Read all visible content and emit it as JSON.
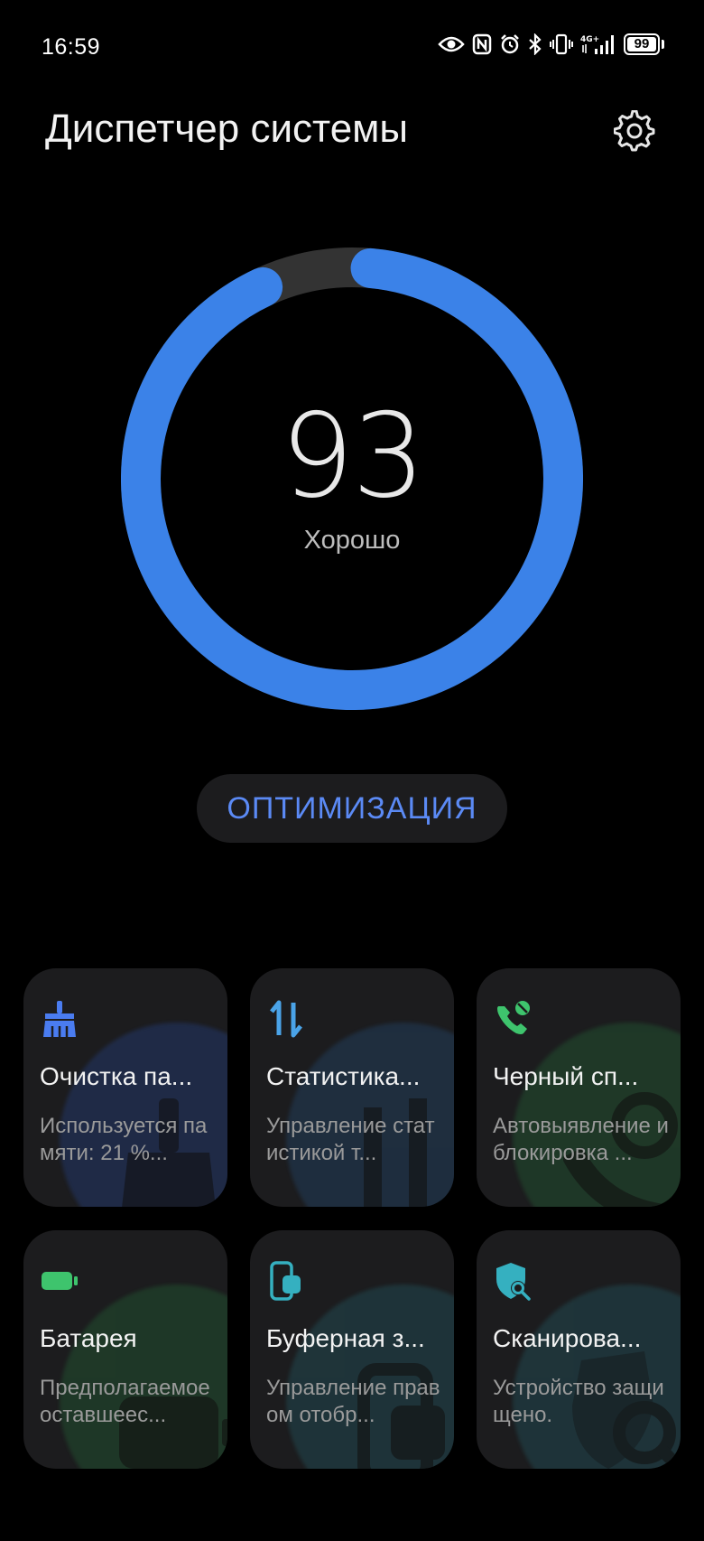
{
  "status_bar": {
    "time": "16:59",
    "network_label": "4G+",
    "battery_level": "99"
  },
  "header": {
    "title": "Диспетчер системы",
    "settings_icon": "gear-icon"
  },
  "score": {
    "value": "93",
    "status": "Хорошо",
    "progress_fraction": 0.93,
    "ring_color": "#3b82e8",
    "track_color": "#333333"
  },
  "optimize_button": {
    "label": "ОПТИМИЗАЦИЯ",
    "color": "#5b8af5"
  },
  "tiles": [
    {
      "title": "Очистка па...",
      "subtitle": "Используется памяти: 21 %...",
      "icon": "broom-icon",
      "accent": "#4a7cf0"
    },
    {
      "title": "Статистика...",
      "subtitle": "Управление статистикой т...",
      "icon": "data-transfer-icon",
      "accent": "#4aa3e8"
    },
    {
      "title": "Черный сп...",
      "subtitle": "Автовыявление и блокировка ...",
      "icon": "blocked-call-icon",
      "accent": "#3ec46d"
    },
    {
      "title": "Батарея",
      "subtitle": "Предполагаемое оставшеес...",
      "icon": "battery-icon",
      "accent": "#3ec46d"
    },
    {
      "title": "Буферная з...",
      "subtitle": "Управление правом отобр...",
      "icon": "clipboard-icon",
      "accent": "#35b0c0"
    },
    {
      "title": "Сканирова...",
      "subtitle": "Устройство защищено.",
      "icon": "shield-scan-icon",
      "accent": "#35b0c0"
    }
  ]
}
